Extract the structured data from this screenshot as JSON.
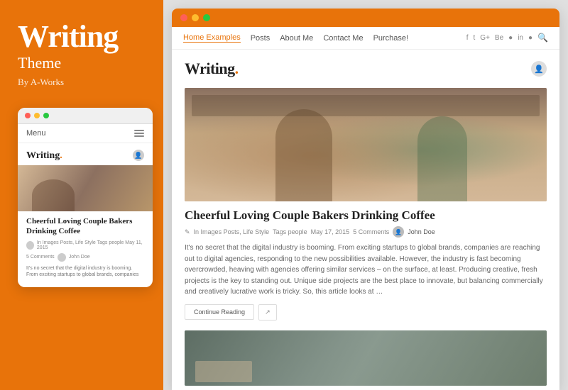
{
  "left_panel": {
    "title": "Writing",
    "subtitle": "Theme",
    "byline": "By A-Works"
  },
  "mobile_preview": {
    "dots": [
      "red",
      "yellow",
      "green"
    ],
    "menu_text": "Menu",
    "logo": "Writing",
    "logo_dot": ".",
    "article": {
      "title": "Cheerful Loving Couple Bakers Drinking Coffee",
      "meta": "In Images Posts, Life Style  Tags people  May 11, 2015",
      "author": "John Doe",
      "excerpt": "It's no secret that the digital industry is booming. From exciting startups to global brands, companies"
    }
  },
  "browser": {
    "dots": [
      "red",
      "yellow",
      "green"
    ],
    "nav": {
      "links": [
        "Home Examples",
        "Posts",
        "About Me",
        "Contact Me",
        "Purchase!"
      ],
      "active_link": "Home Examples",
      "social_icons": [
        "f",
        "t",
        "G+",
        "Be",
        "●",
        "in",
        "●"
      ],
      "search_icon": "🔍"
    },
    "blog_title": "Writing",
    "blog_title_dot": ".",
    "hero_article": {
      "title": "Cheerful Loving Couple Bakers Drinking Coffee",
      "meta_icon": "✎",
      "meta_categories": "In Images Posts, Life Style",
      "meta_tags": "Tags people",
      "meta_date": "May 17, 2015",
      "meta_comments": "5 Comments",
      "author": "John Doe",
      "excerpt": "It's no secret that the digital industry is booming. From exciting startups to global brands, companies are reaching out to digital agencies, responding to the new possibilities available. However, the industry is fast becoming overcrowded, heaving with agencies offering similar services – on the surface, at least. Producing creative, fresh projects is the key to standing out. Unique side projects are the best place to innovate, but balancing commercially and creatively lucrative work is tricky. So, this article looks at …",
      "continue_reading": "Continue Reading",
      "share_icon": "↗"
    }
  },
  "colors": {
    "orange": "#E8730A",
    "white": "#ffffff",
    "dark": "#222222",
    "gray": "#888888"
  }
}
